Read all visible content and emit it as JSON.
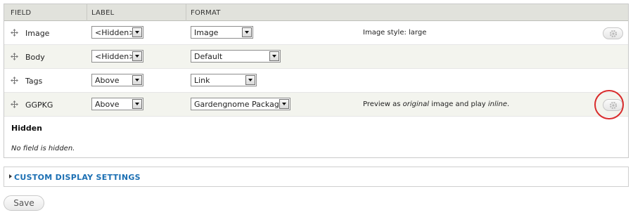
{
  "table": {
    "headers": {
      "field": "FIELD",
      "label": "LABEL",
      "format": "FORMAT"
    },
    "rows": [
      {
        "field": "Image",
        "label": "<Hidden>",
        "format": "Image",
        "summary": "Image style: large",
        "has_gear": true
      },
      {
        "field": "Body",
        "label": "<Hidden>",
        "format": "Default",
        "summary": "",
        "has_gear": false
      },
      {
        "field": "Tags",
        "label": "Above",
        "format": "Link",
        "summary": "",
        "has_gear": false
      },
      {
        "field": "GGPKG",
        "label": "Above",
        "format": "Gardengnome Package",
        "summary_parts": [
          "Preview as ",
          "original",
          " image and play ",
          "inline",
          "."
        ],
        "has_gear": true
      }
    ]
  },
  "hidden_region": {
    "title": "Hidden",
    "empty_message": "No field is hidden."
  },
  "custom_display_settings": {
    "label": "CUSTOM DISPLAY SETTINGS"
  },
  "actions": {
    "save_label": "Save"
  },
  "colors": {
    "highlight": "#d92b2b",
    "link": "#1b6fb3",
    "header_bg": "#e1e2dc",
    "even_row_bg": "#f3f4ee"
  }
}
